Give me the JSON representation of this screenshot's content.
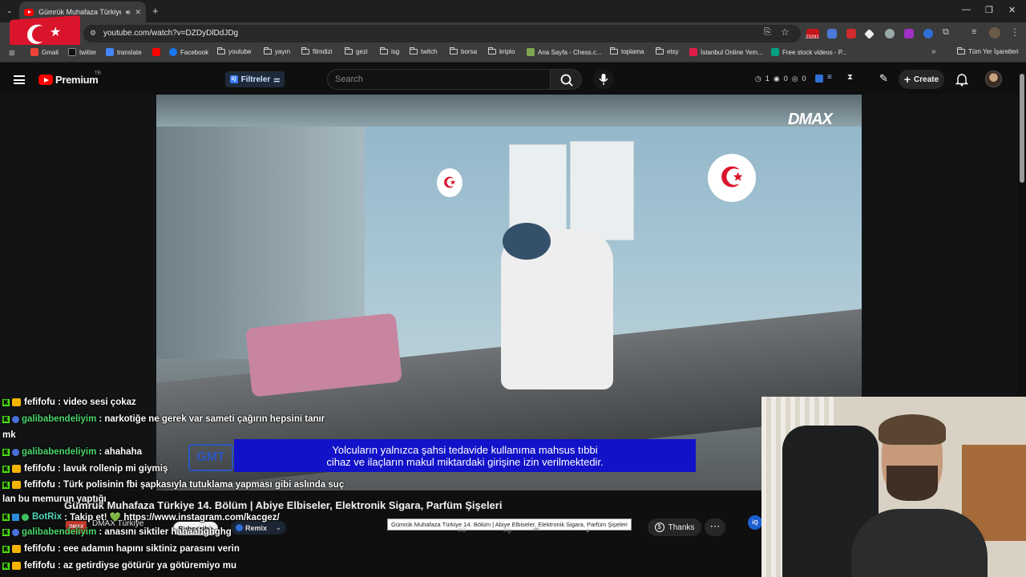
{
  "browser": {
    "tab_title": "Gümrük Muhafaza Türkiye",
    "url": "youtube.com/watch?v=DZDyDlDdJDg",
    "extension_badge": "23291",
    "bookmarks": [
      {
        "label": "Gmail"
      },
      {
        "label": "twitter"
      },
      {
        "label": "translate"
      },
      {
        "label": "Facebook"
      },
      {
        "label": "youtube"
      },
      {
        "label": "yayın"
      },
      {
        "label": "filmdizi"
      },
      {
        "label": "gezi"
      },
      {
        "label": "isg"
      },
      {
        "label": "twitch"
      },
      {
        "label": "borsa"
      },
      {
        "label": "kripto"
      },
      {
        "label": "Ana Sayfa - Chess.c..."
      },
      {
        "label": "toplama"
      },
      {
        "label": "etsy"
      },
      {
        "label": "İstanbul Online Yem..."
      },
      {
        "label": "Free stock videos - P..."
      }
    ],
    "all_bookmarks": "Tüm Yer İşaretleri"
  },
  "youtube": {
    "brand": "Premium",
    "region": "TR",
    "filters_label": "Filtreler",
    "search_placeholder": "Search",
    "stats": {
      "a": "1",
      "b": "0",
      "c": "0"
    },
    "create_label": "Create"
  },
  "video": {
    "watermark": "DMAX",
    "subtitle_line1": "Yolcuların yalnızca şahsi tedavide kullanıma mahsus tıbbi",
    "subtitle_line2": "cihaz ve ilaçların makul miktardaki girişine izin verilmektedir.",
    "corner_logo": "GMT",
    "title": "Gümrük Muhafaza Türkiye 14. Bölüm | Abiye Elbiseler, Elektronik Sigara, Parfüm Şişeleri",
    "tooltip": "Gümrük Muhafaza Türkiye 14. Bölüm | Abiye Elbiseler, Elektronik Sigara, Parfüm Şişeleri",
    "channel_logo": "DMAX",
    "channel_name": "DMAX Türkiye",
    "subscribe_label": "Subscribe",
    "remix_label": "Remix",
    "thanks_label": "Thanks",
    "iq_label": "iQ"
  },
  "chat": [
    {
      "user": "fefifofu",
      "color": "white",
      "text": ": video sesi çokaz",
      "badges": [
        "k",
        "crown"
      ]
    },
    {
      "user": "galibabendeliyim",
      "color": "green",
      "text": ": narkotiğe ne gerek var sameti çağırın hepsini tanır",
      "badges": [
        "k",
        "mod"
      ]
    },
    {
      "wrap": "mk"
    },
    {
      "user": "galibabendeliyim",
      "color": "green",
      "text": ": ahahaha",
      "badges": [
        "k",
        "mod"
      ]
    },
    {
      "user": "fefifofu",
      "color": "white",
      "text": ": lavuk rollenip mi giymiş",
      "badges": [
        "k",
        "crown"
      ]
    },
    {
      "user": "fefifofu",
      "color": "white",
      "text": ": Türk polisinin fbi şapkasıyla tutuklama yapması gibi aslında suç",
      "badges": [
        "k",
        "crown"
      ]
    },
    {
      "wrap": "lan bu memurun yaptığı"
    },
    {
      "user": "BotRix",
      "color": "cyan",
      "text": ": Takip et! 💚 https://www.instagram.com/kacgez/",
      "badges": [
        "k",
        "bot",
        "ok"
      ]
    },
    {
      "user": "galibabendeliyim",
      "color": "green",
      "text": ": anasını siktiler hahaahghghg",
      "badges": [
        "k",
        "mod"
      ]
    },
    {
      "user": "fefifofu",
      "color": "white",
      "text": ": eee adamın hapını siktiniz parasını verin",
      "badges": [
        "k",
        "crown"
      ]
    },
    {
      "user": "fefifofu",
      "color": "white",
      "text": ": az getirdiyse götürür ya götüremiyo mu",
      "badges": [
        "k",
        "crown"
      ]
    }
  ]
}
